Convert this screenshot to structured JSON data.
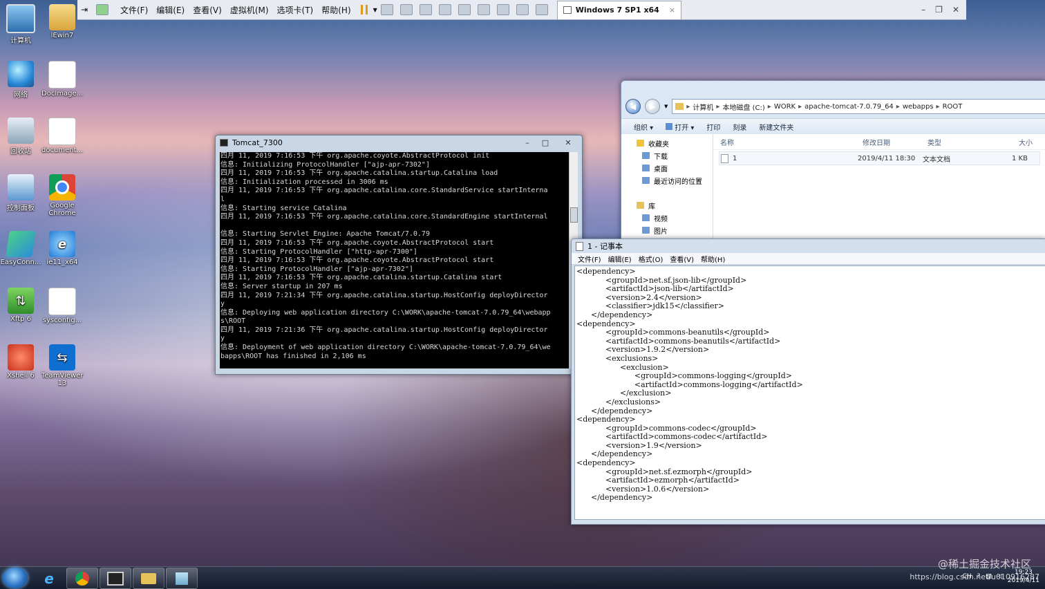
{
  "desktop": {
    "icons": [
      {
        "label": "计算机"
      },
      {
        "label": "lEwin7"
      },
      {
        "label": "网络"
      },
      {
        "label": "DocImage..."
      },
      {
        "label": "回收站"
      },
      {
        "label": "document..."
      },
      {
        "label": "控制面板"
      },
      {
        "label": "Google Chrome"
      },
      {
        "label": "EasyConn..."
      },
      {
        "label": "ie11_x64"
      },
      {
        "label": "Xftp 6"
      },
      {
        "label": "sysconfig..."
      },
      {
        "label": "Xshell 6"
      },
      {
        "label": "TeamViewer 13"
      }
    ]
  },
  "vm_toolbar": {
    "menu": [
      "文件(F)",
      "编辑(E)",
      "查看(V)",
      "虚拟机(M)",
      "选项卡(T)",
      "帮助(H)"
    ],
    "tab_title": "Windows 7 SP1 x64",
    "tab_close": "×"
  },
  "tomcat": {
    "title": "Tomcat_7300",
    "lines": [
      "四月 11, 2019 7:16:53 下午 org.apache.coyote.AbstractProtocol init",
      "信息: Initializing ProtocolHandler [\"ajp-apr-7302\"]",
      "四月 11, 2019 7:16:53 下午 org.apache.catalina.startup.Catalina load",
      "信息: Initialization processed in 3006 ms",
      "四月 11, 2019 7:16:53 下午 org.apache.catalina.core.StandardService startInterna",
      "l",
      "信息: Starting service Catalina",
      "四月 11, 2019 7:16:53 下午 org.apache.catalina.core.StandardEngine startInternal",
      "",
      "信息: Starting Servlet Engine: Apache Tomcat/7.0.79",
      "四月 11, 2019 7:16:53 下午 org.apache.coyote.AbstractProtocol start",
      "信息: Starting ProtocolHandler [\"http-apr-7300\"]",
      "四月 11, 2019 7:16:53 下午 org.apache.coyote.AbstractProtocol start",
      "信息: Starting ProtocolHandler [\"ajp-apr-7302\"]",
      "四月 11, 2019 7:16:53 下午 org.apache.catalina.startup.Catalina start",
      "信息: Server startup in 207 ms",
      "四月 11, 2019 7:21:34 下午 org.apache.catalina.startup.HostConfig deployDirector",
      "y",
      "信息: Deploying web application directory C:\\WORK\\apache-tomcat-7.0.79_64\\webapp",
      "s\\ROOT",
      "四月 11, 2019 7:21:36 下午 org.apache.catalina.startup.HostConfig deployDirector",
      "y",
      "信息: Deployment of web application directory C:\\WORK\\apache-tomcat-7.0.79_64\\we",
      "bapps\\ROOT has finished in 2,106 ms"
    ]
  },
  "explorer": {
    "breadcrumb": [
      "计算机",
      "本地磁盘 (C:)",
      "WORK",
      "apache-tomcat-7.0.79_64",
      "webapps",
      "ROOT"
    ],
    "commands": [
      "组织 ▾",
      "打开 ▾",
      "打印",
      "刻录",
      "新建文件夹"
    ],
    "nav": [
      "收藏夹",
      "下载",
      "桌面",
      "最近访问的位置",
      "库",
      "视频",
      "图片"
    ],
    "columns": [
      "名称",
      "修改日期",
      "类型",
      "大小"
    ],
    "files": [
      {
        "name": "1",
        "modified": "2019/4/11 18:30",
        "type": "文本文档",
        "size": "1 KB"
      }
    ]
  },
  "notepad": {
    "title": "1 - 记事本",
    "menu": [
      "文件(F)",
      "编辑(E)",
      "格式(O)",
      "查看(V)",
      "帮助(H)"
    ],
    "text": "<dependency>\n\t\t<groupId>net.sf.json-lib</groupId>\n\t\t<artifactId>json-lib</artifactId>\n\t\t<version>2.4</version>\n\t\t<classifier>jdk15</classifier>\n\t</dependency>\n<dependency>\n\t\t<groupId>commons-beanutils</groupId>\n\t\t<artifactId>commons-beanutils</artifactId>\n\t\t<version>1.9.2</version>\n\t\t<exclusions>\n\t\t\t<exclusion>\n\t\t\t\t<groupId>commons-logging</groupId>\n\t\t\t\t<artifactId>commons-logging</artifactId>\n\t\t\t</exclusion>\n\t\t</exclusions>\n\t</dependency>\n<dependency>\n\t\t<groupId>commons-codec</groupId>\n\t\t<artifactId>commons-codec</artifactId>\n\t\t<version>1.9</version>\n\t</dependency>\n<dependency>\n\t\t<groupId>net.sf.ezmorph</groupId>\n\t\t<artifactId>ezmorph</artifactId>\n\t\t<version>1.0.6</version>\n\t</dependency>"
  },
  "taskbar": {
    "lang": "CH",
    "time": "19:23",
    "date": "2019/4/11"
  },
  "watermark": "@稀土掘金技术社区",
  "url_watermark": "https://blog.csdn.net/u010916287"
}
